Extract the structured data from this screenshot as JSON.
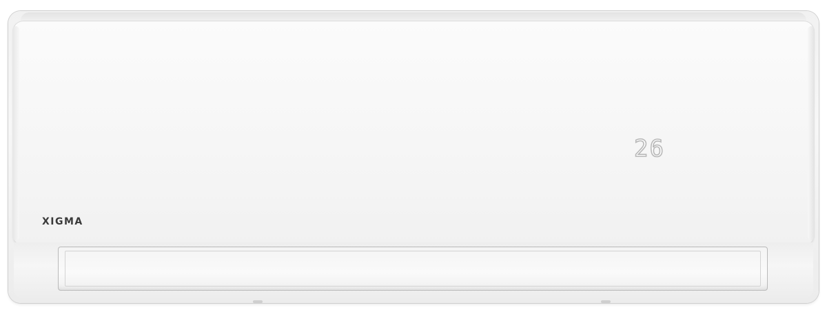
{
  "product": {
    "brand": "XIGMA",
    "display_value": "26"
  }
}
